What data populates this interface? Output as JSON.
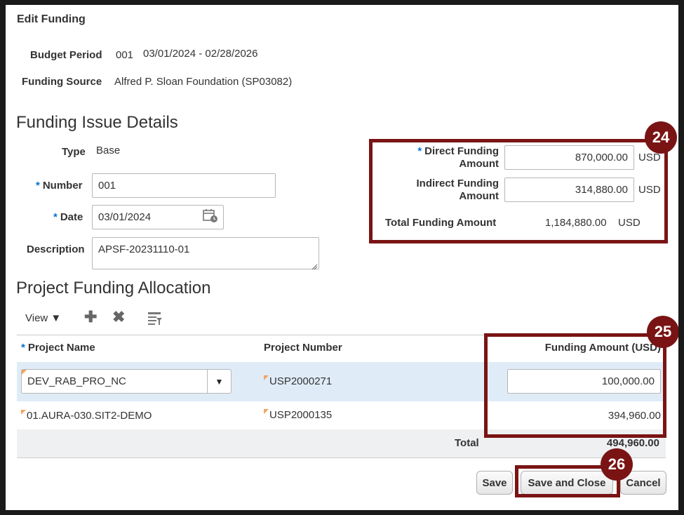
{
  "dialog": {
    "title": "Edit Funding"
  },
  "budget": {
    "label": "Budget Period",
    "number": "001",
    "range": "03/01/2024 - 02/28/2026"
  },
  "source": {
    "label": "Funding Source",
    "value": "Alfred P. Sloan Foundation (SP03082)"
  },
  "issue": {
    "heading": "Funding Issue Details",
    "type_label": "Type",
    "type_value": "Base",
    "number_label": "Number",
    "number_value": "001",
    "date_label": "Date",
    "date_value": "03/01/2024",
    "desc_label": "Description",
    "desc_value": "APSF-20231110-01"
  },
  "amounts": {
    "direct_label_1": "Direct Funding",
    "direct_label_2": "Amount",
    "direct_value": "870,000.00",
    "indirect_label_1": "Indirect Funding",
    "indirect_label_2": "Amount",
    "indirect_value": "314,880.00",
    "total_label": "Total Funding Amount",
    "total_value": "1,184,880.00",
    "currency": "USD"
  },
  "allocation": {
    "heading": "Project Funding Allocation",
    "view_label": "View",
    "columns": {
      "name": "Project Name",
      "number": "Project Number",
      "amount": "Funding Amount (USD)"
    },
    "rows": [
      {
        "name": "DEV_RAB_PRO_NC",
        "number": "USP2000271",
        "amount": "100,000.00"
      },
      {
        "name": "01.AURA-030.SIT2-DEMO",
        "number": "USP2000135",
        "amount": "394,960.00"
      }
    ],
    "total_label": "Total",
    "total_value": "494,960.00"
  },
  "buttons": {
    "save": "Save",
    "save_close": "Save and Close",
    "cancel": "Cancel"
  },
  "badges": {
    "b24": "24",
    "b25": "25",
    "b26": "26"
  },
  "colors": {
    "annotation": "#7a1414",
    "selected_row": "#dfecf8",
    "required": "#0572ce"
  }
}
